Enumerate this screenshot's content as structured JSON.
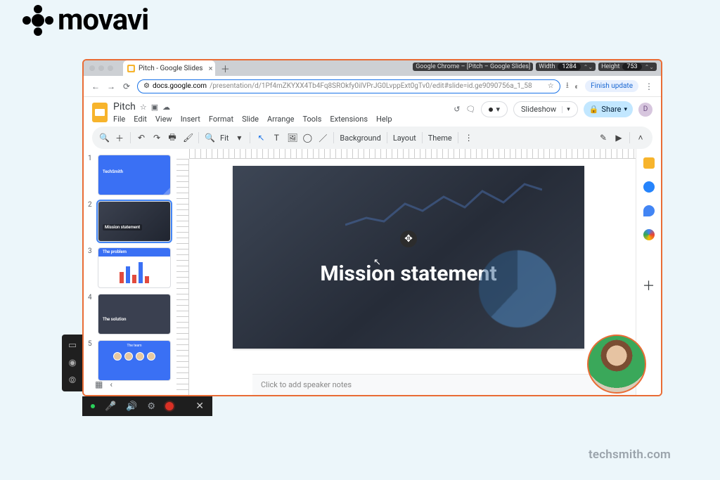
{
  "brand": {
    "name": "movavi"
  },
  "footer": {
    "text": "techsmith.com"
  },
  "recorder_overlay": {
    "chrome_label": "Google Chrome – [Pitch – Google Slides]",
    "width_label": "Width",
    "width_value": "1284",
    "height_label": "Height",
    "height_value": "753"
  },
  "browser": {
    "tab_title": "Pitch - Google Slides",
    "url_domain": "docs.google.com",
    "url_rest": "/presentation/d/1Pf4mZKYXX4Tb4Fq8SROkfy0ilVPrJG0LvppExt0gTv0/edit#slide=id.ge9090756a_1_58",
    "finish_update": "Finish update"
  },
  "doc": {
    "title": "Pitch",
    "menus": [
      "File",
      "Edit",
      "View",
      "Insert",
      "Format",
      "Slide",
      "Arrange",
      "Tools",
      "Extensions",
      "Help"
    ],
    "slideshow": "Slideshow",
    "share": "Share",
    "avatar_letter": "D"
  },
  "toolbar": {
    "zoom": "Fit",
    "background": "Background",
    "layout": "Layout",
    "theme": "Theme"
  },
  "slides": [
    {
      "num": "1",
      "label": "TechSmith"
    },
    {
      "num": "2",
      "label": "Mission statement"
    },
    {
      "num": "3",
      "label": "The problem"
    },
    {
      "num": "4",
      "label": "The solution"
    },
    {
      "num": "5",
      "label": "The team"
    }
  ],
  "canvas": {
    "title": "Mission statement",
    "speaker_placeholder": "Click to add speaker notes"
  }
}
